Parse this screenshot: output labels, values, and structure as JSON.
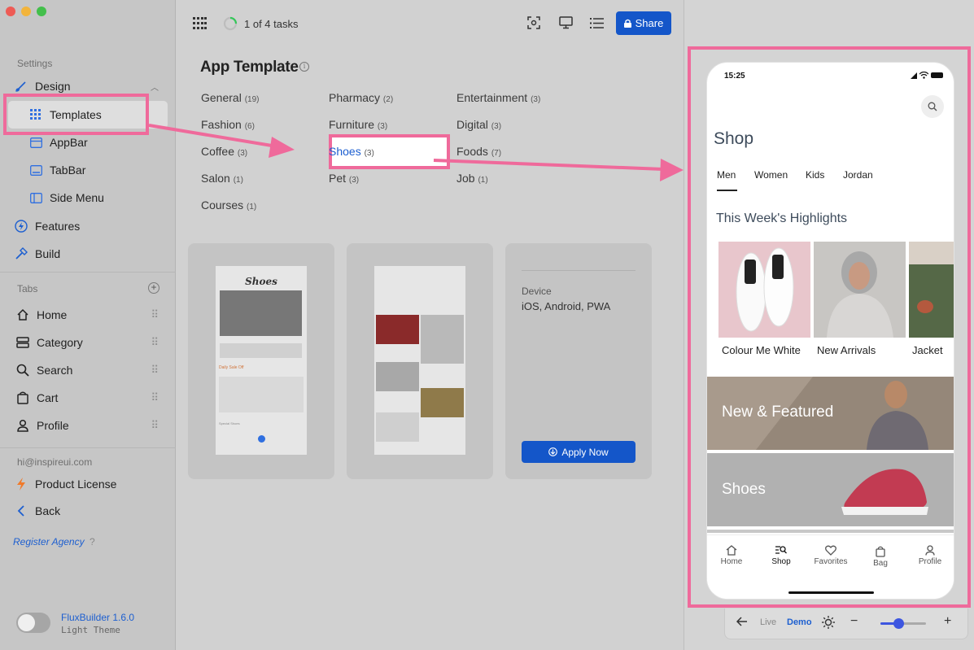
{
  "sidebar": {
    "section_settings": "Settings",
    "design": "Design",
    "templates": "Templates",
    "appbar": "AppBar",
    "tabbar": "TabBar",
    "side_menu": "Side Menu",
    "features": "Features",
    "build": "Build",
    "section_tabs": "Tabs",
    "tabs": [
      "Home",
      "Category",
      "Search",
      "Cart",
      "Profile"
    ],
    "email": "hi@inspireui.com",
    "product_license": "Product License",
    "back": "Back",
    "register_agency": "Register Agency",
    "help_mark": "?",
    "app_version": "FluxBuilder 1.6.0",
    "theme_label": "Light Theme"
  },
  "toolbar": {
    "tasks": "1 of 4 tasks",
    "tasks_progress": 0.25,
    "share": "Share"
  },
  "main": {
    "title": "App Template",
    "categories_col1": [
      {
        "name": "General",
        "count": "(19)"
      },
      {
        "name": "Fashion",
        "count": "(6)"
      },
      {
        "name": "Coffee",
        "count": "(3)"
      },
      {
        "name": "Salon",
        "count": "(1)"
      },
      {
        "name": "Courses",
        "count": "(1)"
      }
    ],
    "categories_col2": [
      {
        "name": "Pharmacy",
        "count": "(2)"
      },
      {
        "name": "Furniture",
        "count": "(3)"
      },
      {
        "name": "Shoes",
        "count": "(3)"
      },
      {
        "name": "Pet",
        "count": "(3)"
      }
    ],
    "categories_col3": [
      {
        "name": "Entertainment",
        "count": "(3)"
      },
      {
        "name": "Digital",
        "count": "(3)"
      },
      {
        "name": "Foods",
        "count": "(7)"
      },
      {
        "name": "Job",
        "count": "(1)"
      }
    ],
    "selected_category": "Shoes",
    "card1_brand": "Shoes",
    "card1_sale": "Daily Sale Off",
    "card1_special": "Special Shoes",
    "device_label": "Device",
    "device_value": "iOS, Android, PWA",
    "apply_now": "Apply Now"
  },
  "phone": {
    "time": "15:25",
    "title": "Shop",
    "tabs": [
      "Men",
      "Women",
      "Kids",
      "Jordan"
    ],
    "active_tab": "Men",
    "highlights_title": "This Week's Highlights",
    "highlights": [
      "Colour Me White",
      "New Arrivals",
      "Jacket"
    ],
    "banner1": "New & Featured",
    "banner2": "Shoes",
    "nav": [
      "Home",
      "Shop",
      "Favorites",
      "Bag",
      "Profile"
    ],
    "active_nav": "Shop"
  },
  "preview_controls": {
    "live": "Live",
    "demo": "Demo",
    "zoom_level": 0.4
  },
  "colors": {
    "accent": "#1d5fd0",
    "annotation_pink": "#ef6a9b",
    "share_button": "#1456c9",
    "apply_button": "#1456c9",
    "progress_green": "#34c759"
  }
}
